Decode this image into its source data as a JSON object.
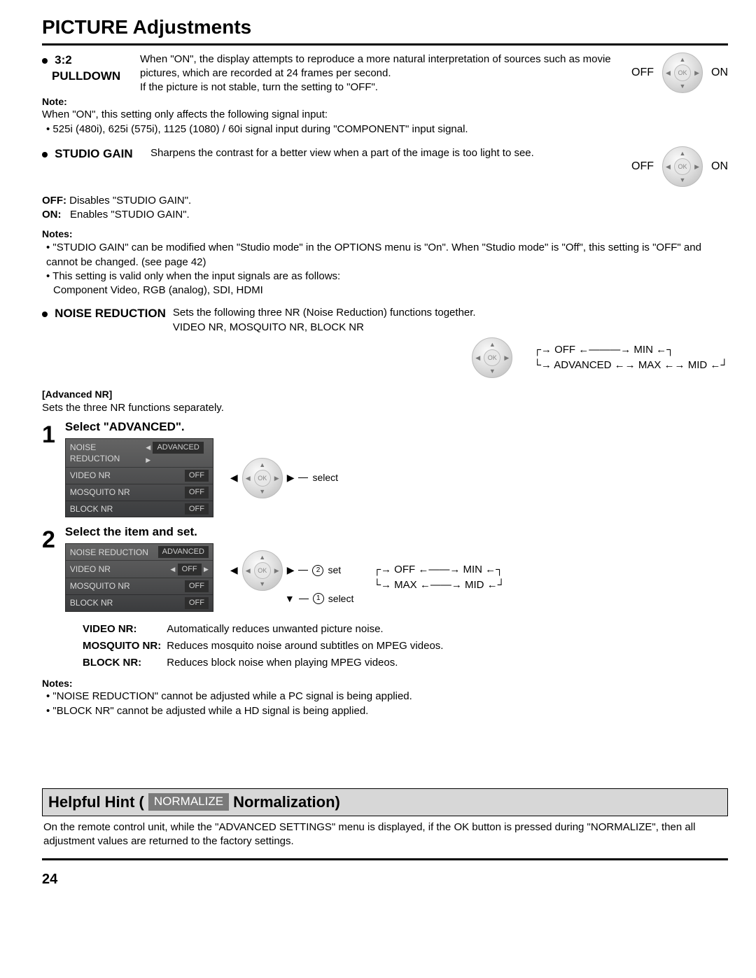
{
  "title": "PICTURE Adjustments",
  "pulldown": {
    "heading1": "3:2",
    "heading2": "PULLDOWN",
    "body1": "When \"ON\", the display attempts to reproduce a more natural interpretation of sources such as movie pictures, which are recorded at 24 frames per second.",
    "body2": "If the picture is not stable, turn the setting to \"OFF\".",
    "off": "OFF",
    "on": "ON",
    "note_h": "Note:",
    "note1": "When \"ON\", this setting only affects the following signal input:",
    "note2": "525i (480i), 625i (575i), 1125 (1080) / 60i signal input during \"COMPONENT\" input signal."
  },
  "studio": {
    "heading": "STUDIO GAIN",
    "body": "Sharpens the contrast for a better view when a part of the image is too light to see.",
    "off": "OFF",
    "on": "ON",
    "off_l": "OFF:",
    "off_d": "Disables \"STUDIO GAIN\".",
    "on_l": "ON:",
    "on_d": "Enables \"STUDIO GAIN\".",
    "notes_h": "Notes:",
    "n1": "\"STUDIO GAIN\" can be modified when \"Studio mode\" in the OPTIONS menu is \"On\". When \"Studio mode\" is \"Off\", this setting is \"OFF\" and cannot be changed. (see page 42)",
    "n2": "This setting is valid only when the input signals are as follows:",
    "n3": "Component Video, RGB (analog), SDI, HDMI"
  },
  "nr": {
    "heading": "NOISE REDUCTION",
    "body": "Sets the following three NR (Noise Reduction) functions together.",
    "sub": "VIDEO NR, MOSQUITO NR, BLOCK NR",
    "flow_off": "OFF",
    "flow_min": "MIN",
    "flow_adv": "ADVANCED",
    "flow_max": "MAX",
    "flow_mid": "MID",
    "adv_h": "[Advanced NR]",
    "adv_d": "Sets the three NR functions separately.",
    "step1_title": "Select \"ADVANCED\".",
    "step2_title": "Select the item and set.",
    "select": "select",
    "set": "set",
    "osd": {
      "row1_l": "NOISE REDUCTION",
      "row1_v": "ADVANCED",
      "row2_l": "VIDEO NR",
      "row2_v": "OFF",
      "row3_l": "MOSQUITO NR",
      "row3_v": "OFF",
      "row4_l": "BLOCK NR",
      "row4_v": "OFF"
    },
    "flow2_off": "OFF",
    "flow2_min": "MIN",
    "flow2_max": "MAX",
    "flow2_mid": "MID",
    "v_k": "VIDEO NR:",
    "v_d": "Automatically reduces unwanted picture noise.",
    "m_k": "MOSQUITO NR:",
    "m_d": "Reduces mosquito noise around subtitles on MPEG videos.",
    "b_k": "BLOCK NR:",
    "b_d": "Reduces block noise when playing MPEG videos.",
    "notes_h": "Notes:",
    "nn1": "\"NOISE REDUCTION\" cannot be adjusted while a PC signal is being applied.",
    "nn2": "\"BLOCK NR\" cannot be adjusted while a HD signal is being applied."
  },
  "hint": {
    "h1": "Helpful Hint (",
    "norm": "NORMALIZE",
    "h2": " Normalization)",
    "body": "On the remote control unit, while the \"ADVANCED SETTINGS\" menu is displayed, if the OK button is pressed during \"NORMALIZE\", then all adjustment values are returned to the factory settings."
  },
  "page": "24"
}
